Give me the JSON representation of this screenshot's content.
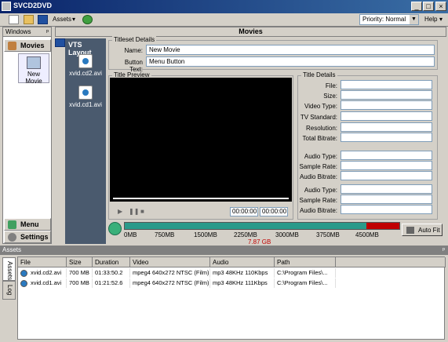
{
  "window": {
    "title": "SVCD2DVD",
    "minimize": "_",
    "maximize": "□",
    "close": "×"
  },
  "toolbar": {
    "assets_label": "Assets",
    "priority_value": "Priority: Normal",
    "help_label": "Help"
  },
  "left_pane": {
    "header": "Windows",
    "movie_item": "New Movie"
  },
  "nav": {
    "movies": "Movies",
    "menu": "Menu",
    "settings": "Settings"
  },
  "main": {
    "header": "Movies"
  },
  "vts": {
    "title": "VTS Layout",
    "items": [
      "xvid.cd2.avi",
      "xvid.cd1.avi"
    ]
  },
  "titleset": {
    "legend": "Titleset Details",
    "name_label": "Name:",
    "name_value": "New Movie",
    "button_label": "Button Text:",
    "button_value": "Menu Button"
  },
  "preview": {
    "legend": "Title Preview",
    "time_current": "00:00:00",
    "time_total": "00:00:00"
  },
  "title_details": {
    "legend": "Title Details",
    "labels": [
      "File:",
      "Size:",
      "Video Type:",
      "TV Standard:",
      "Resolution:",
      "Total Bitrate:",
      "Audio Type:",
      "Sample Rate:",
      "Audio Bitrate:",
      "Audio Type:",
      "Sample Rate:",
      "Audio Bitrate:"
    ]
  },
  "capacity": {
    "ticks": [
      "0MB",
      "750MB",
      "1500MB",
      "2250MB",
      "3000MB",
      "3750MB",
      "4500MB"
    ],
    "total": "7.87 GB",
    "used_fraction": 0.88,
    "autofit_label": "Auto Fit",
    "fill_color": "#2a9a8a",
    "over_color": "#c00000"
  },
  "assets": {
    "header": "Assets",
    "side_tabs": [
      "Assets",
      "Log"
    ],
    "columns": [
      "File",
      "Size",
      "Duration",
      "Video",
      "Audio",
      "Path"
    ],
    "rows": [
      [
        "xvid.cd2.avi",
        "700 MB",
        "01:33:50.2",
        "mpeg4 640x272 NTSC (Film)",
        "mp3 48KHz 110Kbps",
        "C:\\Program Files\\..."
      ],
      [
        "xvid.cd1.avi",
        "700 MB",
        "01:21:52.6",
        "mpeg4 640x272 NTSC (Film)",
        "mp3 48KHz 111Kbps",
        "C:\\Program Files\\..."
      ]
    ]
  }
}
